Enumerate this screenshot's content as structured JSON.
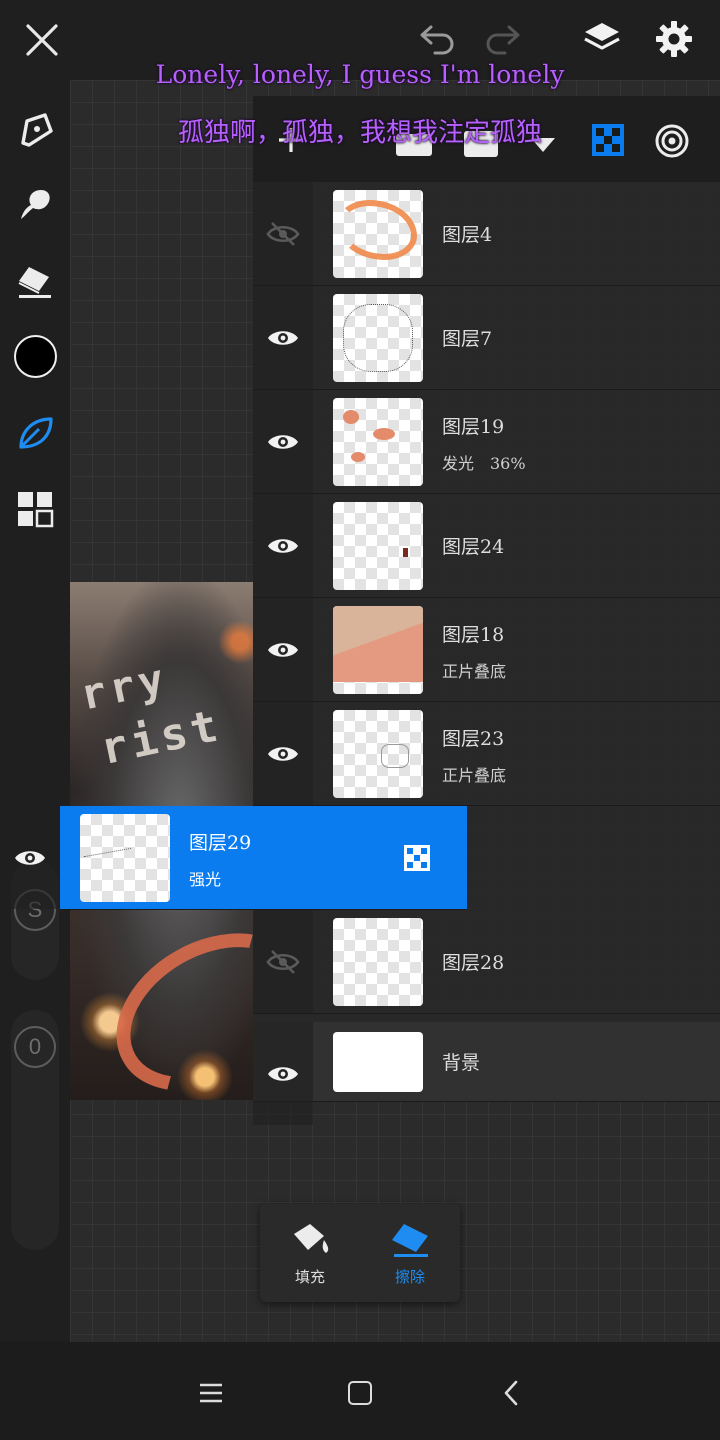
{
  "lyrics": {
    "line1": "Lonely, lonely, I guess I'm lonely",
    "line2": "孤独啊，孤独，我想我注定孤独"
  },
  "artwork": {
    "text_fragments": [
      "rry",
      "rist"
    ]
  },
  "left_toolbar": {
    "color_swatch": "#000000",
    "slider_size_label": "S",
    "slider_opacity_label": "0"
  },
  "layers": [
    {
      "name": "图层4",
      "mode": "",
      "visible": false,
      "selected": false
    },
    {
      "name": "图层7",
      "mode": "",
      "visible": true,
      "selected": false
    },
    {
      "name": "图层19",
      "mode": "发光　36%",
      "visible": true,
      "selected": false
    },
    {
      "name": "图层24",
      "mode": "",
      "visible": true,
      "selected": false
    },
    {
      "name": "图层18",
      "mode": "正片叠底",
      "visible": true,
      "selected": false
    },
    {
      "name": "图层23",
      "mode": "正片叠底",
      "visible": true,
      "selected": false
    },
    {
      "name": "图层29",
      "mode": "强光",
      "visible": true,
      "selected": true
    },
    {
      "name": "图层28",
      "mode": "",
      "visible": false,
      "selected": false
    },
    {
      "name": "背景",
      "mode": "",
      "visible": true,
      "selected": false
    }
  ],
  "tool_popup": {
    "fill_label": "填充",
    "erase_label": "擦除"
  },
  "colors": {
    "accent": "#0a7cf0",
    "lyric": "#b660ff"
  }
}
